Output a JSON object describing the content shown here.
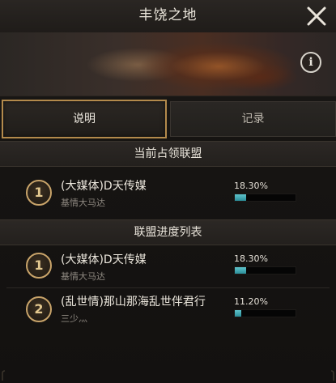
{
  "header": {
    "title": "丰饶之地"
  },
  "tabs": [
    {
      "label": "说明"
    },
    {
      "label": "记录"
    }
  ],
  "occupying": {
    "title": "当前占领联盟",
    "entry": {
      "rank": "1",
      "name": "(大媒体)D天传媒",
      "leader": "基情大马达",
      "percent_text": "18.30%",
      "progress": 0.183
    }
  },
  "progress_list": {
    "title": "联盟进度列表",
    "entries": [
      {
        "rank": "1",
        "name": "(大媒体)D天传媒",
        "leader": "基情大马达",
        "percent_text": "18.30%",
        "progress": 0.183
      },
      {
        "rank": "2",
        "name": "(乱世情)那山那海乱世伴君行",
        "leader": "三少灬",
        "percent_text": "11.20%",
        "progress": 0.112
      }
    ]
  },
  "icons": {
    "close": "close-icon",
    "info": "info-icon"
  },
  "colors": {
    "accent_gold": "#b38a4c",
    "progress_teal": "#3fa9b3"
  }
}
